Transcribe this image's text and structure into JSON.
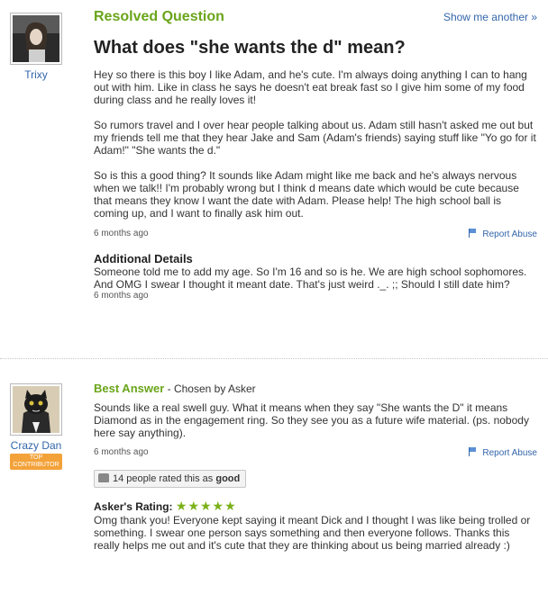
{
  "question": {
    "status": "Resolved Question",
    "show_more": "Show me another »",
    "title": "What does \"she wants the d\" mean?",
    "asker": "Trixy",
    "paragraphs": [
      "Hey so there is this boy I like Adam, and he's cute. I'm always doing anything I can to hang out with him. Like in class he says he doesn't eat break fast so I give him some of my food during class and he really loves it!",
      "So rumors travel and I over hear people talking about us. Adam still hasn't asked me out but my friends tell me that they hear Jake and Sam (Adam's friends) saying stuff like \"Yo go for it Adam!\" \"She wants the d.\"",
      "So is this a good thing? It sounds like Adam might like me back and he's always nervous when we talk!! I'm probably wrong but I think d means date which would be cute because that means they know I want the date with Adam. Please help! The high school ball is coming up, and I want to finally ask him out."
    ],
    "time": "6 months ago",
    "report": "Report Abuse",
    "additional_title": "Additional Details",
    "additional_text": "Someone told me to add my age. So I'm 16 and so is he. We are high school sophomores. And OMG I swear I thought it meant date. That's just weird ._. ;; Should I still date him?",
    "additional_time": "6 months ago"
  },
  "answer": {
    "label": "Best Answer",
    "chosen": " - Chosen by Asker",
    "answerer": "Crazy Dan",
    "badge_line1": "TOP",
    "badge_line2": "CONTRIBUTOR",
    "text": "Sounds like a real swell guy. What it means when they say \"She wants the D\" it means Diamond as in the engagement ring. So they see you as a future wife material. (ps. nobody here say anything).",
    "time": "6 months ago",
    "report": "Report Abuse",
    "rated_prefix": "14 people rated this as ",
    "rated_word": "good",
    "rating_label": "Asker's Rating:",
    "rating_stars": "★★★★★",
    "rating_comment": "Omg thank you! Everyone kept saying it meant Dick and I thought I was like being trolled or something. I swear one person says something and then everyone follows. Thanks this really helps me out and it's cute that they are thinking about us being married already :)"
  },
  "colors": {
    "green": "#6aa51a",
    "link": "#3366aa",
    "badge": "#f3a23a"
  }
}
